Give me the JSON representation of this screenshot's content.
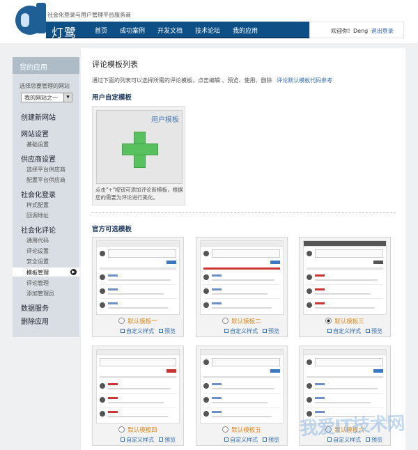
{
  "header": {
    "slogan": "社会化登录与用户管理平台服务商",
    "brand": "灯鹭",
    "nav": [
      "首页",
      "成功案例",
      "开发文档",
      "技术论坛",
      "我的应用"
    ],
    "welcome": "欢迎你！Deng",
    "logout": "退出登录"
  },
  "sidebar": {
    "title": "我的应用",
    "select_label": "选择您要管理的网站",
    "select_value": "我的网站之一",
    "create_site": "创建新网站",
    "groups": [
      {
        "label": "网站设置",
        "items": [
          "基础设置"
        ]
      },
      {
        "label": "供应商设置",
        "items": [
          "选择平台供应商",
          "配置平台供应商"
        ]
      },
      {
        "label": "社会化登录",
        "items": [
          "样式配置",
          "回调地址"
        ]
      },
      {
        "label": "社会化评论",
        "items": [
          "通用代码",
          "评论设置",
          "安全设置",
          "模板管理",
          "评论管理",
          "添加管理员"
        ]
      }
    ],
    "active_item": "模板管理",
    "data_service": "数据服务",
    "delete_app": "删除应用"
  },
  "main": {
    "title": "评论模板列表",
    "desc": "通过下面的列表可以选择所需的评论模板，点击编辑 、预览、使用、删除",
    "desc_link": "评论默认模板代码参考",
    "custom_heading": "用户自定模板",
    "custom_card": {
      "label": "用户模板",
      "hint": "点击\"+\"按钮可添加评论新模板，根据您的需要为评论进行美化。"
    },
    "official_heading": "官方可选模板",
    "templates": [
      {
        "name": "默认模板一",
        "selected": false,
        "customize": "自定义样式",
        "preview": "预览"
      },
      {
        "name": "默认模板二",
        "selected": false,
        "customize": "自定义样式",
        "preview": "预览"
      },
      {
        "name": "默认模板三",
        "selected": true,
        "customize": "自定义样式",
        "preview": "预览"
      },
      {
        "name": "默认模板四",
        "selected": false,
        "customize": "自定义样式",
        "preview": "预览"
      },
      {
        "name": "默认模板五",
        "selected": false,
        "customize": "自定义样式",
        "preview": "预览"
      },
      {
        "name": "默认模板六",
        "selected": false,
        "customize": "自定义样式",
        "preview": "预览"
      }
    ]
  },
  "watermark": "我爱IT技术网",
  "colors": {
    "nav": "#0e4f86",
    "accent_link": "#2f6db5",
    "plus": "#58c05d",
    "template_name": "#e28a1a"
  }
}
